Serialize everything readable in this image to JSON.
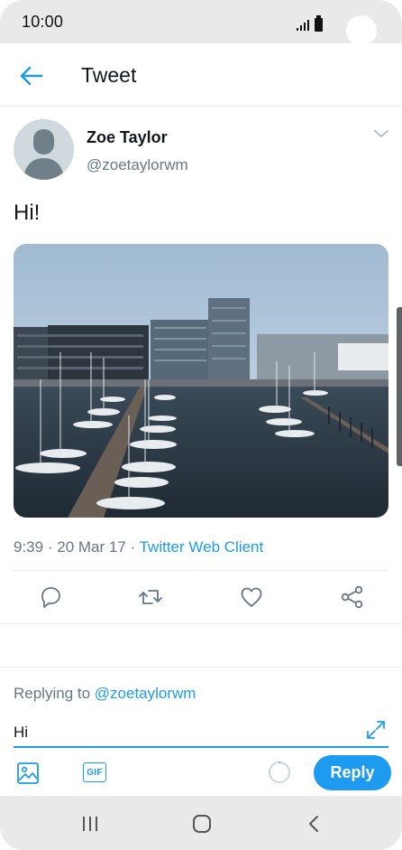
{
  "status_bar": {
    "time": "10:00",
    "signal_icon": "signal-icon",
    "battery_icon": "battery-icon"
  },
  "header": {
    "back_icon": "arrow-left-icon",
    "title": "Tweet"
  },
  "tweet": {
    "author_name": "Zoe Taylor",
    "author_handle": "@zoetaylorwm",
    "text": "Hi!",
    "media_alt": "harbor-photo",
    "time": "9:39",
    "separator": "·",
    "date": "20 Mar 17",
    "client": "Twitter Web Client",
    "actions": [
      "reply-icon",
      "retweet-icon",
      "like-icon",
      "share-icon"
    ]
  },
  "composer": {
    "replying_label": "Replying to",
    "replying_handle": "@zoetaylorwm",
    "input_value": "Hi",
    "reply_button": "Reply",
    "tools": [
      "image-icon",
      "gif-icon"
    ],
    "gif_label": "GIF"
  },
  "nav_bar": {
    "buttons": [
      "recent-apps-icon",
      "home-icon",
      "back-icon"
    ]
  },
  "colors": {
    "accent": "#1d9bf0",
    "muted_text": "#657786",
    "system_bar": "#e9e9ea"
  }
}
